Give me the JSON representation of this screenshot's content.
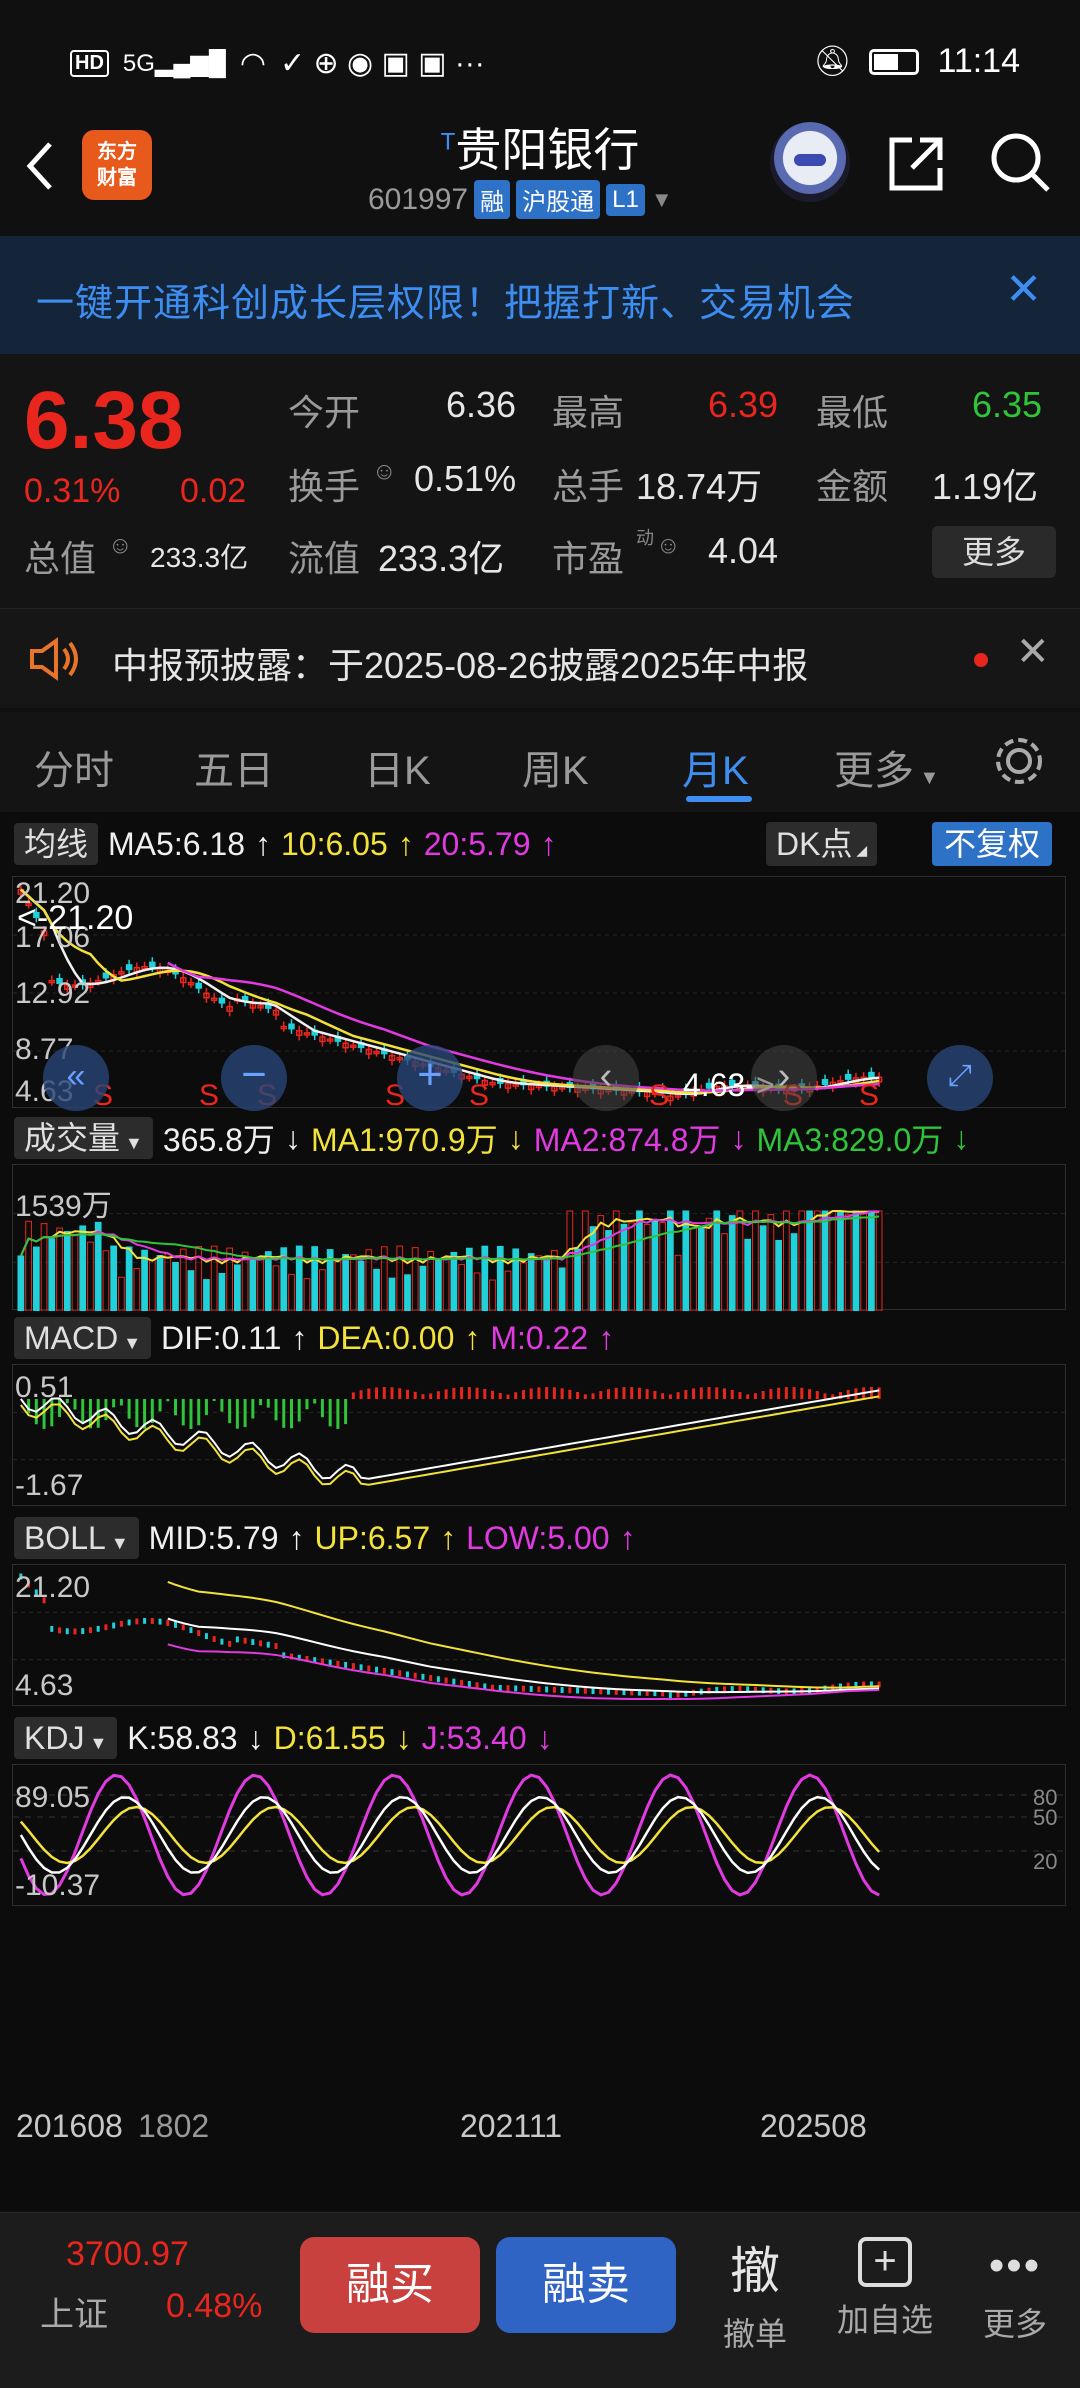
{
  "status": {
    "left_icons": [
      "HD",
      "5G",
      "signal-icon",
      "wifi-icon",
      "app-icons"
    ],
    "time": "11:14"
  },
  "header": {
    "logo_line1": "东方",
    "logo_line2": "财富",
    "title_prefix": "T",
    "title": "贵阳银行",
    "code": "601997",
    "tags": [
      "融",
      "沪股通",
      "L1"
    ]
  },
  "banner": {
    "text": "一键开通科创成长层权限！把握打新、交易机会"
  },
  "quote": {
    "price": "6.38",
    "pct": "0.31%",
    "change": "0.02",
    "open_label": "今开",
    "open": "6.36",
    "high_label": "最高",
    "high": "6.39",
    "low_label": "最低",
    "low": "6.35",
    "turnover_label": "换手",
    "turnover": "0.51%",
    "volume_label": "总手",
    "volume": "18.74万",
    "amount_label": "金额",
    "amount": "1.19亿",
    "mktcap_label": "总值",
    "mktcap": "233.3亿",
    "float_label": "流值",
    "float": "233.3亿",
    "pe_label": "市盈",
    "pe_sup": "动",
    "pe": "4.04",
    "more": "更多"
  },
  "notice": {
    "text": "中报预披露：于2025-08-26披露2025年中报"
  },
  "tabs": [
    "分时",
    "五日",
    "日K",
    "周K",
    "月K",
    "更多"
  ],
  "active_tab": "月K",
  "ma": {
    "btn": "均线",
    "ma5": "MA5:6.18",
    "ma10": "10:6.05",
    "ma20": "20:5.79",
    "dk": "DK点",
    "fq": "不复权"
  },
  "kline": {
    "y_labels": [
      "21.20",
      "17.06",
      "12.92",
      "8.77",
      "4.63"
    ],
    "max_note": "<-21.20",
    "min_note": "4.63->"
  },
  "volume": {
    "btn": "成交量",
    "vol": "365.8万",
    "ma1": "MA1:970.9万",
    "ma2": "MA2:874.8万",
    "ma3": "MA3:829.0万",
    "y_label": "1539万"
  },
  "macd": {
    "btn": "MACD",
    "dif": "DIF:0.11",
    "dea": "DEA:0.00",
    "m": "M:0.22",
    "y_top": "0.51",
    "y_bot": "-1.67"
  },
  "boll": {
    "btn": "BOLL",
    "mid": "MID:5.79",
    "up": "UP:6.57",
    "low": "LOW:5.00",
    "y_top": "21.20",
    "y_bot": "4.63"
  },
  "kdj": {
    "btn": "KDJ",
    "k": "K:58.83",
    "d": "D:61.55",
    "j": "J:53.40",
    "y_top": "89.05",
    "y_bot": "-10.37",
    "r80": "80",
    "r50": "50",
    "r20": "20"
  },
  "x_axis": [
    "201608",
    "1802",
    "202111",
    "202508"
  ],
  "bottom": {
    "index_value": "3700.97",
    "index_name": "上证",
    "index_pct": "0.48%",
    "buy": "融买",
    "sell": "融卖",
    "cancel_glyph": "撤",
    "cancel": "撤单",
    "add": "加自选",
    "more": "更多"
  },
  "colors": {
    "up": "#e8261d",
    "down": "#21d0d8",
    "accent": "#3d8ef0",
    "ma5": "#f0f0f0",
    "ma10": "#f3e23a",
    "ma20": "#e03ae0",
    "ma3": "#2fc43a"
  }
}
